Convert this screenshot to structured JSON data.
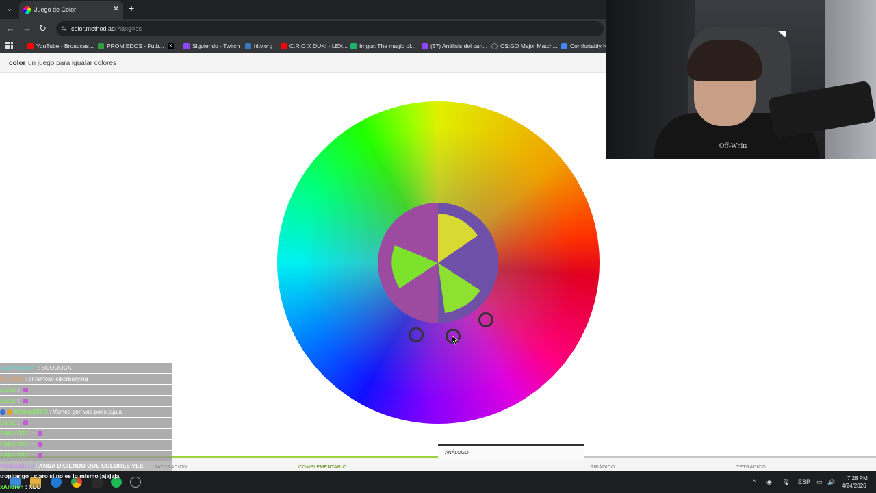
{
  "browser": {
    "tab_title": "Juego de Color",
    "url_host": "color.method.ac",
    "url_path": "/?lang=es",
    "bookmarks": [
      {
        "label": "YouTube - Broadcas...",
        "color": "#ff0000"
      },
      {
        "label": "PROMIEDOS - Futb...",
        "color": "#2ea043"
      },
      {
        "label": "",
        "color": "#ffffff"
      },
      {
        "label": "Siguiendo - Twitch",
        "color": "#9146ff"
      },
      {
        "label": "hltv.org",
        "color": "#3a78c4"
      },
      {
        "label": "C.R.O X DUKI - LEX...",
        "color": "#ff0000"
      },
      {
        "label": "Imgur: The magic of...",
        "color": "#1bb76e"
      },
      {
        "label": "(57) Análisis del can...",
        "color": "#9146ff"
      },
      {
        "label": "CS:GO Major Match...",
        "color": "#888888"
      },
      {
        "label": "Comfortably N",
        "color": "#4285f4"
      }
    ]
  },
  "page": {
    "brand": "color",
    "tagline": "un juego para igualar colores"
  },
  "modes": {
    "saturacion": "SATURACIÓN",
    "complementario": "COMPLEMENTARIO",
    "analogo": "ANÁLOGO",
    "triadico": "TRIÁDICO",
    "tetradico": "TETRÁDICO"
  },
  "game": {
    "inner_base_color": "#9c4ba0",
    "inner_right_color": "#6f50a8",
    "wedge_colors": [
      "#d9d933",
      "#7ce22c",
      "#8ee130"
    ],
    "progress_fraction": 0.5
  },
  "webcam": {
    "shirt_text": "Off-White"
  },
  "chat": [
    {
      "user": "LordPalomero",
      "text": "BOOOOCA",
      "user_color": "#5fd4d4"
    },
    {
      "user": "NT_Killer",
      "text": "el famoso ciberbullying",
      "user_color": "#ff9a3c"
    },
    {
      "user": "Darsic",
      "text": "",
      "user_color": "#7cff4c",
      "emote": true
    },
    {
      "user": "Darsic",
      "text": "",
      "user_color": "#7cff4c",
      "emote": true
    },
    {
      "user": "MathiasR333",
      "text": "Vamos gon vos poes jajaja",
      "user_color": "#7cff4c",
      "badge": true
    },
    {
      "user": "Darsic",
      "text": "",
      "user_color": "#7cff4c",
      "emote": true
    },
    {
      "user": "DAMYSSJ1",
      "text": "",
      "user_color": "#7cff4c",
      "emote": true
    },
    {
      "user": "DAMYSSJ1",
      "text": "",
      "user_color": "#7cff4c",
      "emote": true
    },
    {
      "user": "DAMYSSJ1",
      "text": "",
      "user_color": "#7cff4c",
      "emote": true
    },
    {
      "user": "NicoCarp912",
      "text": "ANDA DICIENDO QUE COLORES VES",
      "user_color": "#c77dff"
    },
    {
      "user": "tropitango",
      "text": "claro si no es lo mismo jajajaja",
      "user_color": "#ffffff"
    },
    {
      "user": "xAndreh",
      "text": "XDD",
      "user_color": "#7cff4c"
    }
  ],
  "taskbar": {
    "lang": "ESP",
    "time": "7:28 PM",
    "date": "4/24/2026"
  }
}
